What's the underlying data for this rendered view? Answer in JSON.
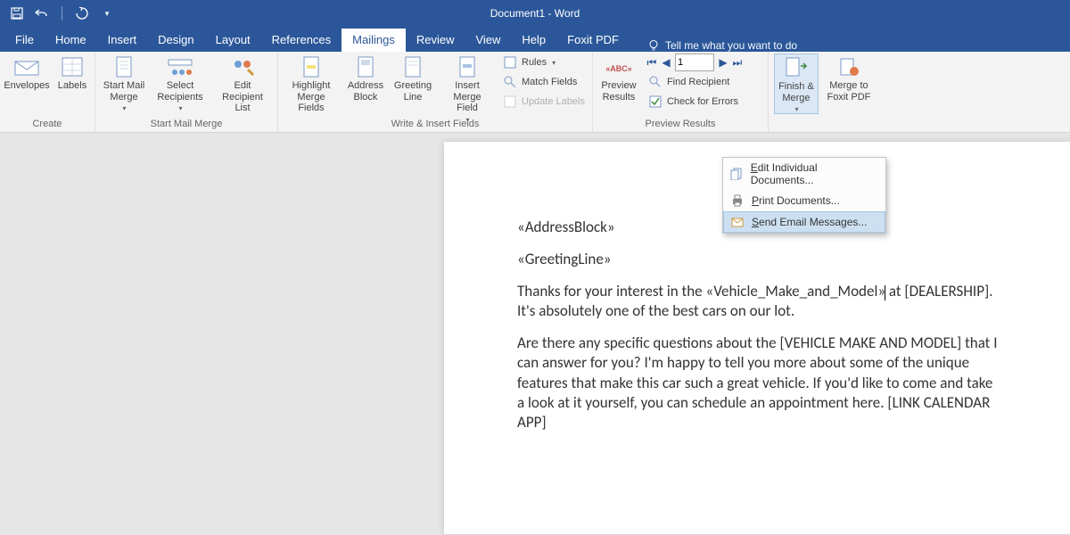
{
  "app_title": "Document1  -  Word",
  "tabs": {
    "file": "File",
    "home": "Home",
    "insert": "Insert",
    "design": "Design",
    "layout": "Layout",
    "references": "References",
    "mailings": "Mailings",
    "review": "Review",
    "view": "View",
    "help": "Help",
    "foxit": "Foxit PDF"
  },
  "tell_me": "Tell me what you want to do",
  "ribbon": {
    "create": {
      "envelopes": "Envelopes",
      "labels": "Labels",
      "group": "Create"
    },
    "start": {
      "start_mail_merge": "Start Mail\nMerge",
      "select_recipients": "Select\nRecipients",
      "edit_recipient_list": "Edit\nRecipient List",
      "group": "Start Mail Merge"
    },
    "write": {
      "highlight": "Highlight\nMerge Fields",
      "address": "Address\nBlock",
      "greeting": "Greeting\nLine",
      "insert_field": "Insert Merge\nField",
      "rules": "Rules",
      "match": "Match Fields",
      "update": "Update Labels",
      "group": "Write & Insert Fields"
    },
    "preview": {
      "preview": "Preview\nResults",
      "record_value": "1",
      "find": "Find Recipient",
      "check": "Check for Errors",
      "group": "Preview Results"
    },
    "finish": {
      "finish_merge": "Finish &\nMerge",
      "merge_foxit": "Merge to\nFoxit PDF",
      "dd_edit": "Edit Individual Documents...",
      "dd_print": "Print Documents...",
      "dd_send": "Send Email Messages..."
    }
  },
  "document": {
    "address_block": "«AddressBlock»",
    "greeting": "«GreetingLine»",
    "para1_a": "Thanks for your interest in the «Vehicle_Make_and_Model»",
    "para1_b": " at [DEALERSHIP]. It's absolutely one of the best cars on our lot.",
    "para2": "Are there any specific questions about the [VEHICLE MAKE AND MODEL] that I can answer for you? I'm happy to tell you more about some of the unique features that make this car such a great vehicle. If you'd like to come and take a look at it yourself, you can schedule an appointment here. [LINK CALENDAR APP]"
  }
}
